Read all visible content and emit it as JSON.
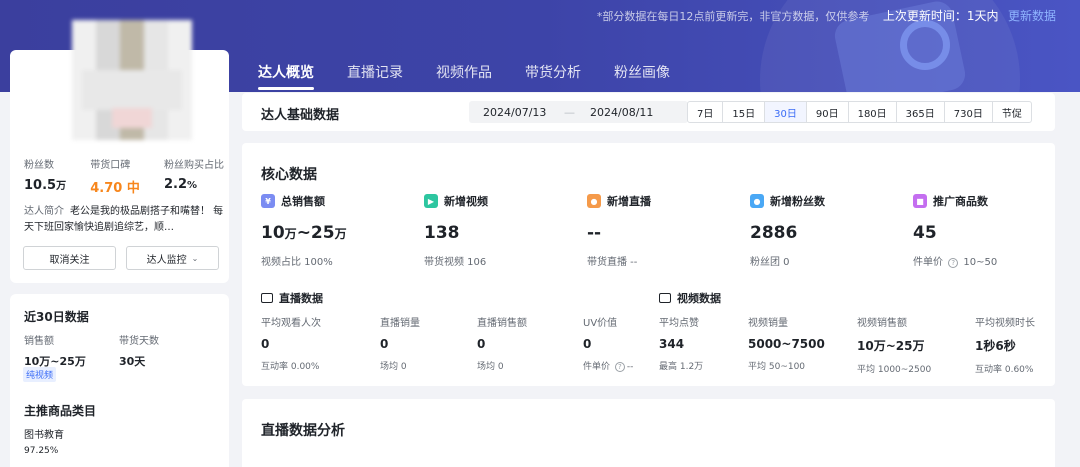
{
  "header": {
    "notice": "*部分数据在每日12点前更新完，非官方数据，仅供参考",
    "last_update": "上次更新时间：1天内",
    "refresh_label": "更新数据"
  },
  "tabs": [
    {
      "label": "达人概览",
      "active": true
    },
    {
      "label": "直播记录",
      "active": false
    },
    {
      "label": "视频作品",
      "active": false
    },
    {
      "label": "带货分析",
      "active": false
    },
    {
      "label": "粉丝画像",
      "active": false
    }
  ],
  "profile": {
    "fans_label": "粉丝数",
    "fans_value": "10.5",
    "fans_unit": "万",
    "reputation_label": "带货口碑",
    "reputation_value": "4.70 中",
    "buy_ratio_label": "粉丝购买占比",
    "buy_ratio_value": "2.2",
    "buy_ratio_unit": "%",
    "intro_label": "达人简介",
    "intro_text": "老公是我的极品剧搭子和嘴替！ 每天下班回家愉快追剧追综艺，顺…",
    "unfollow_label": "取消关注",
    "monitor_label": "达人监控"
  },
  "recent30": {
    "title": "近30日数据",
    "sales_label": "销售额",
    "sales_value": "10万~25万",
    "days_label": "带货天数",
    "days_value": "30天",
    "tag": "纯视频",
    "category_title": "主推商品类目",
    "category_name": "图书教育",
    "category_pct": "97.25%"
  },
  "base": {
    "title": "达人基础数据",
    "date_start": "2024/07/13",
    "date_sep": "—",
    "date_end": "2024/08/11",
    "ranges": [
      "7日",
      "15日",
      "30日",
      "90日",
      "180日",
      "365日",
      "730日",
      "节促"
    ],
    "active_range": "30日"
  },
  "core": {
    "title": "核心数据",
    "metrics": [
      {
        "label": "总销售额",
        "value": "10",
        "unit1": "万",
        "value2": "~25",
        "unit2": "万",
        "sub": "视频占比 100%",
        "icon": "yen-icon",
        "color": "#7b8cf2"
      },
      {
        "label": "新增视频",
        "value": "138",
        "sub": "带货视频 106",
        "icon": "video-icon",
        "color": "#2dc6a0"
      },
      {
        "label": "新增直播",
        "value": "--",
        "sub": "带货直播 --",
        "icon": "live-icon",
        "color": "#f59a4a"
      },
      {
        "label": "新增粉丝数",
        "value": "2886",
        "sub": "粉丝团 0",
        "icon": "user-icon",
        "color": "#4aa8f5"
      },
      {
        "label": "推广商品数",
        "value": "45",
        "sub": "件单价",
        "sub2": "10~50",
        "icon": "bag-icon",
        "color": "#c46ef0"
      }
    ],
    "live_section": "直播数据",
    "video_section": "视频数据",
    "live_metrics": [
      {
        "label": "平均观看人次",
        "value": "0",
        "sub": "互动率 0.00%"
      },
      {
        "label": "直播销量",
        "value": "0",
        "sub": "场均 0"
      },
      {
        "label": "直播销售额",
        "value": "0",
        "sub": "场均 0"
      },
      {
        "label": "UV价值",
        "value": "0",
        "sub": "件单价",
        "sub2": "--"
      }
    ],
    "video_metrics": [
      {
        "label": "平均点赞",
        "value": "344",
        "sub": "最高 1.2万"
      },
      {
        "label": "视频销量",
        "value": "5000~7500",
        "sub": "平均 50~100"
      },
      {
        "label": "视频销售额",
        "value": "10万~25万",
        "sub": "平均 1000~2500"
      },
      {
        "label": "平均视频时长",
        "value": "1秒6秒",
        "sub": "互动率 0.60%"
      }
    ]
  },
  "live_analysis": {
    "title": "直播数据分析"
  }
}
